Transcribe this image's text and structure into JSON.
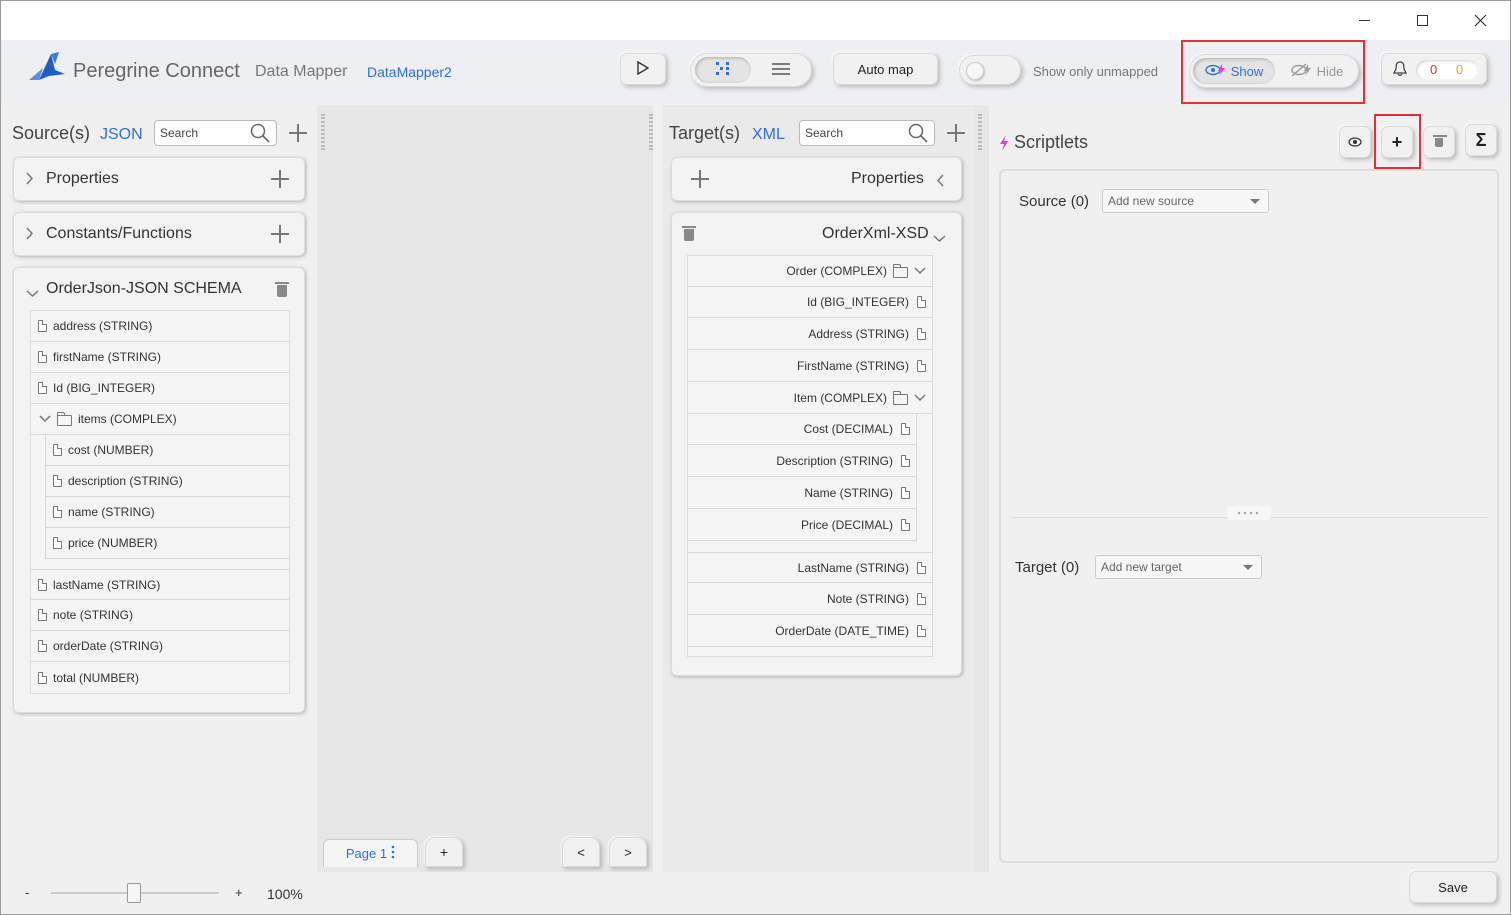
{
  "app": {
    "brand": "Peregrine Connect",
    "product": "Data Mapper",
    "doc_name": "DataMapper2",
    "colors": {
      "accent": "#2f6fe0",
      "logo": "#1e5fc4",
      "highlight": "#e0313b",
      "scriptlet_bolt": "#e23bd0"
    }
  },
  "window_controls": [
    "minimize-icon",
    "maximize-icon",
    "close-icon"
  ],
  "toolbar": {
    "auto_map": "Auto map",
    "show_only_unmapped": "Show only unmapped",
    "show": "Show",
    "hide": "Hide",
    "notif_errors": "0",
    "notif_warnings": "0"
  },
  "source": {
    "title": "Source(s)",
    "type": "JSON",
    "search_placeholder": "Search",
    "properties": "Properties",
    "constants": "Constants/Functions",
    "schema_title": "OrderJson-JSON SCHEMA",
    "fields": [
      "address (STRING)",
      "firstName (STRING)",
      "Id (BIG_INTEGER)",
      "items (COMPLEX)",
      "cost (NUMBER)",
      "description (STRING)",
      "name (STRING)",
      "price (NUMBER)",
      "lastName (STRING)",
      "note (STRING)",
      "orderDate (STRING)",
      "total (NUMBER)"
    ]
  },
  "mapping": {
    "page_tab": "Page 1",
    "add_page": "+",
    "prev": "<",
    "next": ">"
  },
  "target": {
    "title": "Target(s)",
    "type": "XML",
    "search_placeholder": "Search",
    "properties": "Properties",
    "schema_title": "OrderXml-XSD",
    "fields": [
      "Order (COMPLEX)",
      "Id (BIG_INTEGER)",
      "Address (STRING)",
      "FirstName (STRING)",
      "Item (COMPLEX)",
      "Cost (DECIMAL)",
      "Description (STRING)",
      "Name (STRING)",
      "Price (DECIMAL)",
      "LastName (STRING)",
      "Note (STRING)",
      "OrderDate (DATE_TIME)"
    ]
  },
  "scriptlets": {
    "title": "Scriptlets",
    "source_label": "Source (0)",
    "source_placeholder": "Add new source",
    "target_label": "Target (0)",
    "target_placeholder": "Add new target",
    "sigma": "Σ",
    "plus": "+"
  },
  "footer": {
    "zoom_minus": "-",
    "zoom_plus": "+",
    "zoom_level": "100%",
    "zoom_fraction": 0.5,
    "save": "Save"
  }
}
